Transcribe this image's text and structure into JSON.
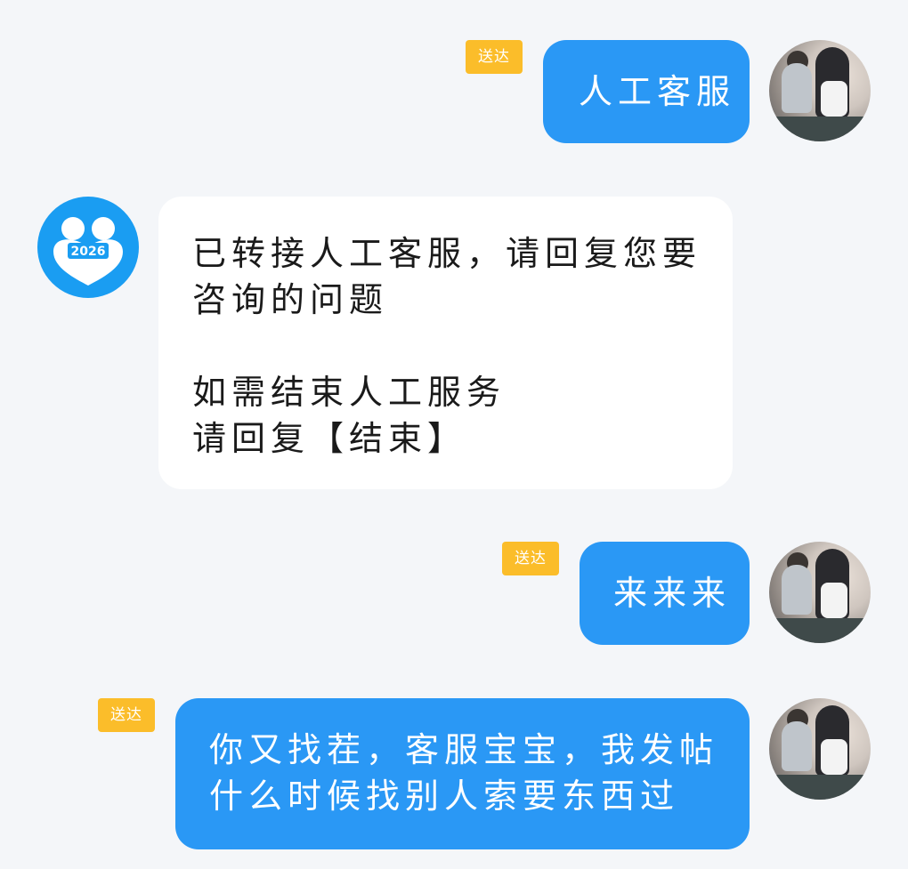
{
  "messages": [
    {
      "side": "right",
      "status": "送达",
      "text": "人工客服"
    },
    {
      "side": "left",
      "text": "已转接人工客服，请回复您要咨询的问题\n\n如需结束人工服务\n请回复【结束】"
    },
    {
      "side": "right",
      "status": "送达",
      "text": "来来来"
    },
    {
      "side": "right",
      "status": "送达",
      "text": "你又找茬，客服宝宝，我发帖什么时候找别人索要东西过"
    }
  ],
  "bot_avatar": {
    "badge_text": "2026",
    "icon": "people-heart-logo-icon",
    "color": "#1a9df2"
  },
  "colors": {
    "sent_bubble": "#2a98f5",
    "received_bubble": "#ffffff",
    "status_tag": "#fbbd2a",
    "background": "#f4f6f9"
  }
}
